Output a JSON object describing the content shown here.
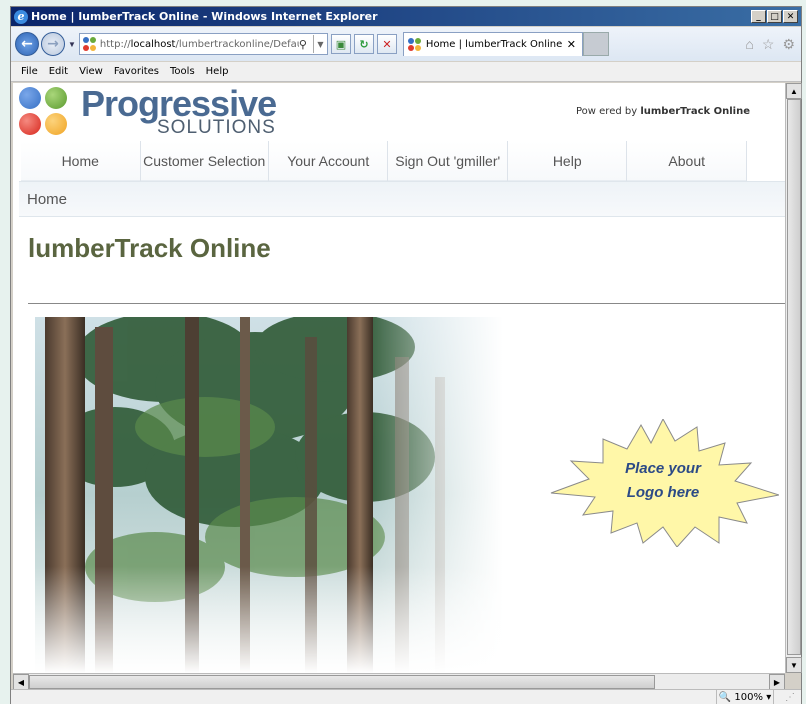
{
  "window": {
    "title": "Home | lumberTrack Online - Windows Internet Explorer",
    "min_label": "_",
    "max_label": "□",
    "close_label": "✕"
  },
  "navbar": {
    "back_label": "←",
    "forward_label": "→",
    "address_prefix": "http://",
    "address_host": "localhost",
    "address_path": "/lumbertrackonline/Default.",
    "tab_title": "Home | lumberTrack Online",
    "tab_close": "✕"
  },
  "menubar": [
    "File",
    "Edit",
    "View",
    "Favorites",
    "Tools",
    "Help"
  ],
  "site": {
    "logo_word": "Progressive",
    "logo_sub": "SOLUTIONS",
    "powered_prefix": "Pow ered by ",
    "powered_product": "lumberTrack Online",
    "nav": [
      "Home",
      "Customer Selection",
      "Your Account",
      "Sign Out 'gmiller'",
      "Help",
      "About"
    ],
    "breadcrumb": "Home",
    "page_title": "lumberTrack Online",
    "logo_placeholder_line1": "Place your",
    "logo_placeholder_line2": "Logo here"
  },
  "status": {
    "zoom": "100%"
  },
  "colors": {
    "dot_blue": "#3670c4",
    "dot_green": "#6aaa3a",
    "dot_red": "#e03a2e",
    "dot_yellow": "#f4b53a",
    "title_olive": "#5a6540",
    "badge_fill": "#fff7a8"
  }
}
